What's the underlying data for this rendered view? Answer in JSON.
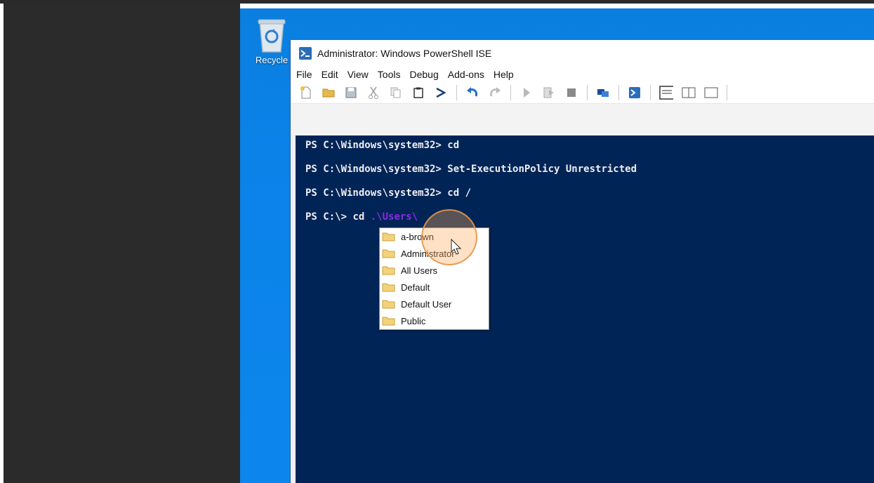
{
  "window": {
    "title": "Administrator: Windows PowerShell ISE"
  },
  "desktop": {
    "recycle_label": "Recycle"
  },
  "menu": [
    "File",
    "Edit",
    "View",
    "Tools",
    "Debug",
    "Add-ons",
    "Help"
  ],
  "toolbar_icons": [
    "new-file-icon",
    "open-folder-icon",
    "save-icon",
    "cut-icon",
    "copy-icon",
    "paste-icon",
    "command-prompt-icon",
    "undo-icon",
    "redo-icon",
    "run-icon",
    "run-selection-icon",
    "stop-icon",
    "remote-powershell-icon",
    "powershell-console-icon",
    "layout-script-top-icon",
    "layout-script-right-icon",
    "layout-maximized-icon"
  ],
  "console": {
    "lines": [
      {
        "prompt": "PS C:\\Windows\\system32> ",
        "command": "cd",
        "arg": ""
      },
      {
        "prompt": "PS C:\\Windows\\system32> ",
        "command": "Set-ExecutionPolicy Unrestricted",
        "arg": ""
      },
      {
        "prompt": "PS C:\\Windows\\system32> ",
        "command": "cd /",
        "arg": ""
      },
      {
        "prompt": "PS C:\\> ",
        "command": "cd ",
        "arg": ".\\Users\\"
      }
    ]
  },
  "completion": {
    "items": [
      "a-brown",
      "Administrator",
      "All Users",
      "Default",
      "Default User",
      "Public"
    ]
  },
  "colors": {
    "console_bg": "#012456",
    "desktop_bg": "#0b83ea",
    "argument": "#8a2be2"
  }
}
